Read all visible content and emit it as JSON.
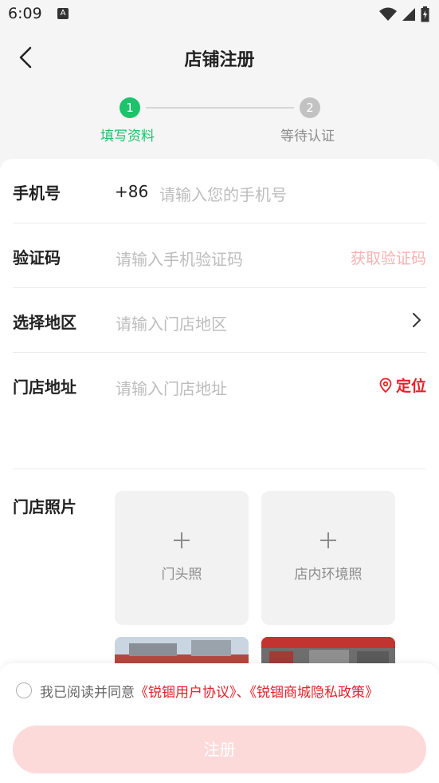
{
  "status_bar": {
    "time": "6:09",
    "a_icon": "A"
  },
  "nav": {
    "title": "店铺注册",
    "back_icon": "chevron-left-icon"
  },
  "steps": [
    {
      "number": "1",
      "label": "填写资料",
      "active": true
    },
    {
      "number": "2",
      "label": "等待认证",
      "active": false
    }
  ],
  "form": {
    "phone": {
      "label": "手机号",
      "prefix": "+86",
      "placeholder": "请输入您的手机号"
    },
    "code": {
      "label": "验证码",
      "placeholder": "请输入手机验证码",
      "action": "获取验证码"
    },
    "region": {
      "label": "选择地区",
      "placeholder": "请输入门店地区"
    },
    "address": {
      "label": "门店地址",
      "placeholder": "请输入门店地址",
      "locate": "定位"
    },
    "photos": {
      "label": "门店照片",
      "front": "门头照",
      "inside": "店内环境照"
    }
  },
  "agreement": {
    "prefix": "我已阅读并同意",
    "user_agreement": "《锐锢用户协议》",
    "separator": "、",
    "privacy_policy": "《锐锢商城隐私政策》"
  },
  "register_button": "注册",
  "colors": {
    "accent_green": "#1dc26b",
    "accent_red": "#e8202a",
    "button_disabled": "#fddada"
  }
}
